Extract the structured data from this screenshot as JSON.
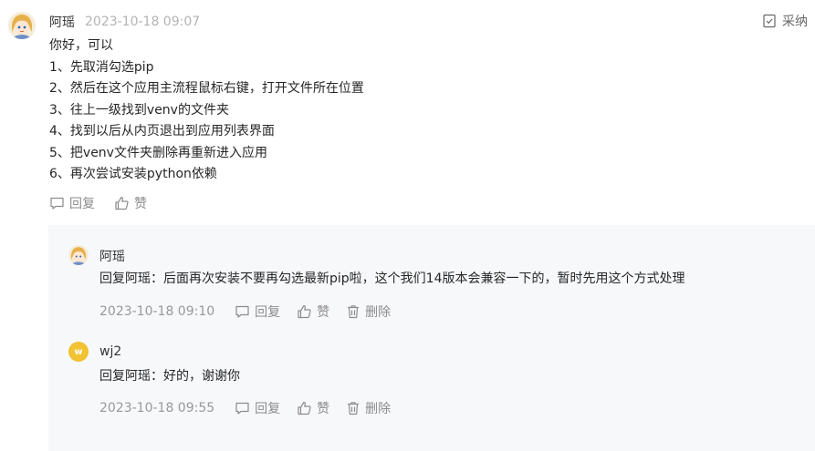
{
  "comment": {
    "author": "阿瑶",
    "time": "2023-10-18 09:07",
    "adopt_label": "采纳",
    "lines": [
      "你好，可以",
      "1、先取消勾选pip",
      "2、然后在这个应用主流程鼠标右键，打开文件所在位置",
      "3、往上一级找到venv的文件夹",
      "4、找到以后从内页退出到应用列表界面",
      "5、把venv文件夹删除再重新进入应用",
      "6、再次尝试安装python依赖"
    ],
    "reply_label": "回复",
    "like_label": "赞"
  },
  "replies": [
    {
      "author": "阿瑶",
      "text": "回复阿瑶：后面再次安装不要再勾选最新pip啦，这个我们14版本会兼容一下的，暂时先用这个方式处理",
      "time": "2023-10-18 09:10",
      "reply_label": "回复",
      "like_label": "赞",
      "delete_label": "删除"
    },
    {
      "author": "wj2",
      "avatar_letter": "w",
      "text": "回复阿瑶：好的，谢谢你",
      "time": "2023-10-18 09:55",
      "reply_label": "回复",
      "like_label": "赞",
      "delete_label": "删除"
    }
  ],
  "colors": {
    "panel_bg": "#f7f8fa",
    "muted": "#8c8c8c",
    "letter_avatar": "#f1c232"
  }
}
